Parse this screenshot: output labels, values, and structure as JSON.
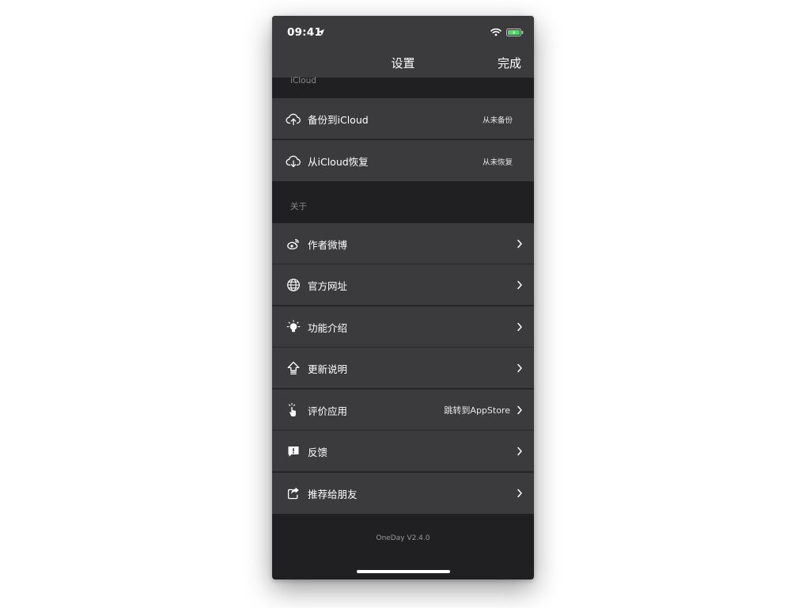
{
  "status_bar": {
    "time": "09:41"
  },
  "nav": {
    "title": "设置",
    "done_label": "完成"
  },
  "sections": {
    "icloud": {
      "header": "iCloud",
      "backup": {
        "label": "备份到iCloud",
        "detail": "从未备份",
        "icon": "cloud-upload-icon"
      },
      "restore": {
        "label": "从iCloud恢复",
        "detail": "从未恢复",
        "icon": "cloud-download-icon"
      }
    },
    "about": {
      "header": "关于",
      "weibo": {
        "label": "作者微博",
        "icon": "weibo-icon"
      },
      "website": {
        "label": "官方网址",
        "icon": "globe-icon"
      },
      "features": {
        "label": "功能介绍",
        "icon": "lightbulb-icon"
      },
      "changelog": {
        "label": "更新说明",
        "icon": "arrow-up-icon"
      },
      "rate": {
        "label": "评价应用",
        "detail": "跳转到AppStore",
        "icon": "tap-hand-icon"
      },
      "feedback": {
        "label": "反馈",
        "icon": "feedback-icon"
      },
      "share": {
        "label": "推荐给朋友",
        "icon": "share-icon"
      }
    }
  },
  "footer": {
    "version": "OneDay V2.4.0"
  },
  "colors": {
    "cell_background": "#3b3b3e",
    "page_background": "#202022",
    "text": "#ffffff",
    "battery_charging": "#4cd964"
  }
}
